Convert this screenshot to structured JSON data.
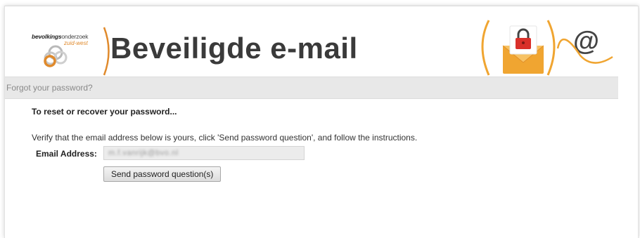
{
  "header": {
    "logo": {
      "name_bold": "bevolkings",
      "name_light": "onderzoek",
      "region": "zuid-west"
    },
    "title": "Beveiligde e-mail",
    "decoration_icons": [
      "padlock-envelope-icon",
      "at-sign-icon"
    ],
    "at_symbol": "@"
  },
  "subbar": {
    "text": "Forgot your password?"
  },
  "form": {
    "heading": "To reset or recover your password...",
    "instructions": "Verify that the email address below is yours, click 'Send password question', and follow the instructions.",
    "email_label": "Email Address:",
    "email_value": "m.f.vanrijk@bvo.nl",
    "send_button_label": "Send password question(s)"
  },
  "colors": {
    "accent_orange": "#e08a2c",
    "title_gray": "#3a3a3a",
    "bar_gray": "#e8e8e8",
    "envelope_orange": "#f0a531",
    "lock_red": "#d9302a"
  }
}
